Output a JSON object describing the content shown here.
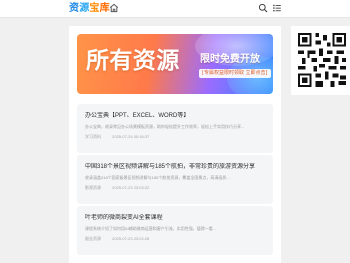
{
  "header": {
    "logo": [
      "资",
      "源",
      "宝",
      "库"
    ]
  },
  "banner": {
    "title": "所有资源",
    "subtitle": "限时免费开放",
    "tagline": "[专属权益限时领取 立即点击]"
  },
  "posts": [
    {
      "title": "办公宝典【PPT、EXCEL、WORD等】",
      "desc": "办公宝典，收录常见办公场景模板资源，助你轻松提升工作效率，轻松上手实用技巧分享...",
      "category": "学习资料",
      "date": "2025-07-24 00:16:37"
    },
    {
      "title": "中国318个景区视频讲解与185个航拍，非常珍贵的旅游资源分享",
      "desc": "收录涵盖318个国家级景区视频讲解与185个航拍资源，覆盖全国景点，高清画质...",
      "category": "影视资源",
      "date": "2025-07-23 23:03:22"
    },
    {
      "title": "叶老师的微商裂变AI全套课程",
      "desc": "课程系统介绍了如何用AI辅助微商运营和客户引流，实用性强，值得一看...",
      "category": "副业资源",
      "date": "2025-07-23 23:02:28"
    }
  ],
  "icons": {
    "home": "home-icon",
    "search": "search-icon",
    "menu": "menu-icon",
    "qr": "qr-code-icon"
  }
}
